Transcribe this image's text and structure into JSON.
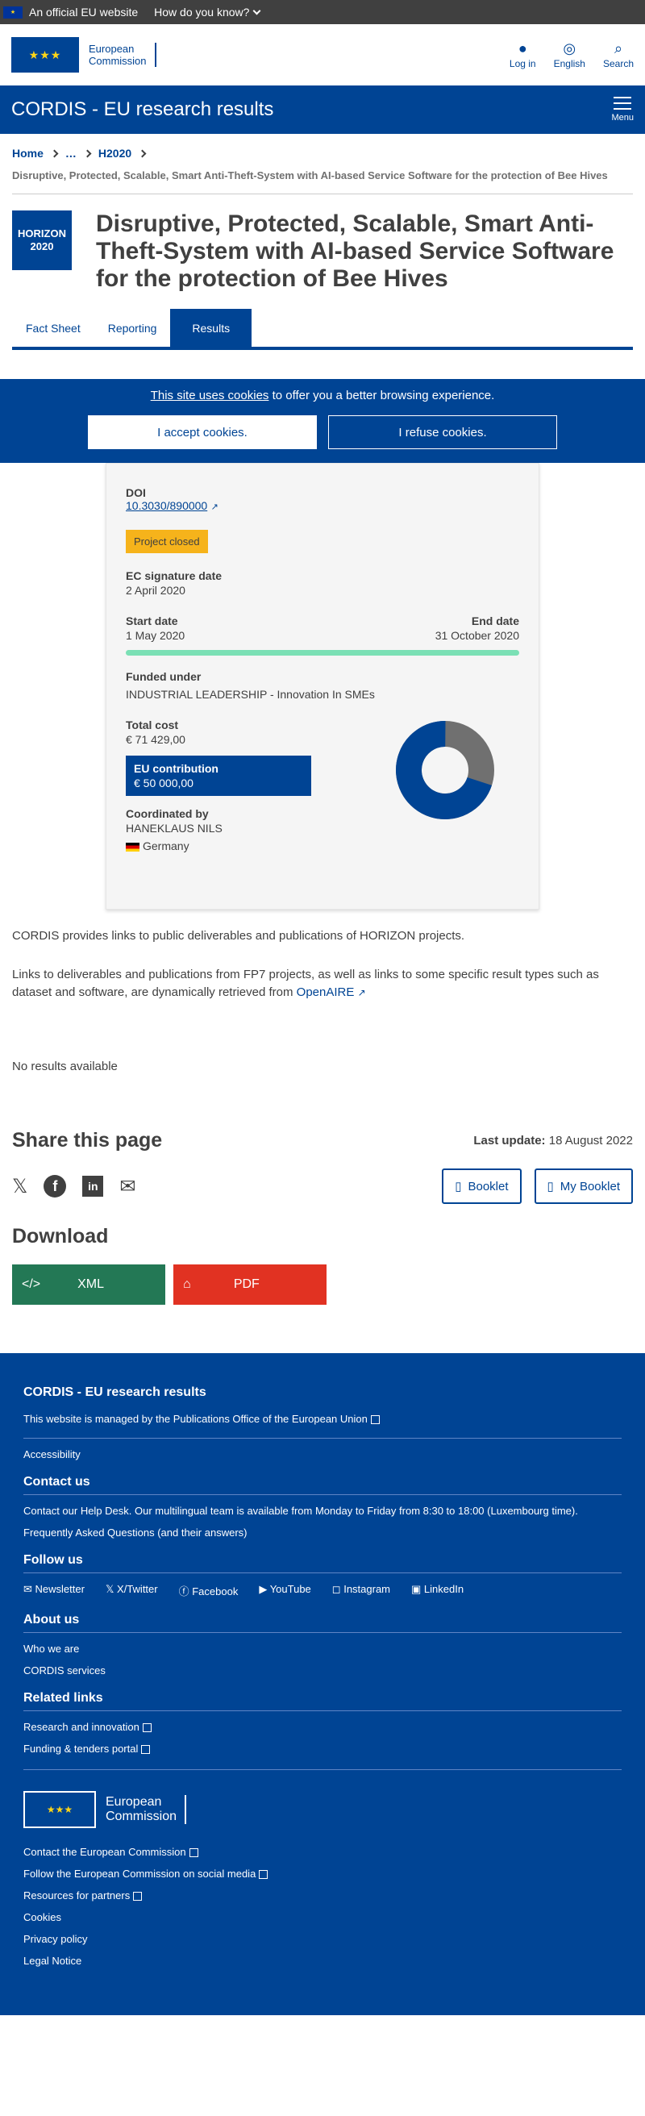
{
  "topbar": {
    "eu_site": "An official EU website",
    "how": "How do you know?"
  },
  "header": {
    "org_line1": "European",
    "org_line2": "Commission",
    "login": "Log in",
    "lang": "English",
    "search": "Search"
  },
  "site": {
    "title": "CORDIS - EU research results",
    "menu": "Menu"
  },
  "breadcrumb": {
    "home": "Home",
    "dots": "…",
    "h2020": "H2020"
  },
  "project": {
    "subtitle": "Disruptive, Protected, Scalable, Smart Anti-Theft-System with AI-based Service Software for the protection of Bee Hives",
    "badge_line1": "HORIZON",
    "badge_line2": "2020",
    "title": "Disruptive, Protected, Scalable, Smart Anti-Theft-System with AI-based Service Software for the protection of Bee Hives"
  },
  "tabs": [
    "Fact Sheet",
    "Reporting",
    "Results"
  ],
  "cookie": {
    "link": "This site uses cookies",
    "text": " to offer you a better browsing experience.",
    "accept": "I accept cookies.",
    "refuse": "I refuse cookies."
  },
  "factsheet": {
    "doi_label": "DOI",
    "doi": "10.3030/890000",
    "status": "Project closed",
    "ec_sig_label": "EC signature date",
    "ec_sig": "2 April 2020",
    "start_label": "Start date",
    "start": "1 May 2020",
    "end_label": "End date",
    "end": "31 October 2020",
    "progress": 1.0,
    "funded_label": "Funded under",
    "funded": "INDUSTRIAL LEADERSHIP - Innovation In SMEs",
    "cost_label": "Total cost",
    "cost": "€ 71 429,00",
    "eu_label": "EU contribution",
    "eu": "€ 50 000,00",
    "eu_share": 0.7,
    "coord_label": "Coordinated by",
    "coord": "HANEKLAUS NILS",
    "country": "Germany",
    "colors": {
      "eu": "#004494",
      "other": "#707070"
    }
  },
  "results": {
    "p1": "CORDIS provides links to public deliverables and publications of HORIZON projects.",
    "p2": "Links to deliverables and publications from FP7 projects, as well as links to some specific result types such as dataset and software, are dynamically retrieved from ",
    "openaire": "OpenAIRE",
    "none": "No results available"
  },
  "share": {
    "title": "Share this page",
    "update_label": "Last update:",
    "update": "18 August 2022",
    "booklet": "Booklet",
    "my_booklet": "My Booklet"
  },
  "download": {
    "title": "Download",
    "xml": "XML",
    "pdf": "PDF",
    "xml_color": "#237855",
    "pdf_color": "#e13222"
  },
  "footer": {
    "title": "CORDIS - EU research results",
    "managed": "This website is managed by the ",
    "pub_office": "Publications Office of the European Union",
    "accessibility": "Accessibility",
    "contact_title": "Contact us",
    "helpdesk": "Contact our Help Desk",
    "helpdesk_text": ". Our multilingual team is available from Monday to Friday from 8:30 to 18:00 (Luxembourg time).",
    "faq": "Frequently Asked Questions",
    "faq_text": " (and their answers)",
    "follow_title": "Follow us",
    "follow": [
      "Newsletter",
      "X/Twitter",
      "Facebook",
      "YouTube",
      "Instagram",
      "LinkedIn"
    ],
    "about_title": "About us",
    "about": [
      "Who we are",
      "CORDIS services"
    ],
    "related_title": "Related links",
    "related": [
      "Research and innovation",
      "Funding & tenders portal"
    ],
    "ec1": "European",
    "ec2": "Commission",
    "ec_links": [
      "Contact the European Commission",
      "Follow the European Commission on social media",
      "Resources for partners",
      "Cookies",
      "Privacy policy",
      "Legal Notice"
    ]
  }
}
